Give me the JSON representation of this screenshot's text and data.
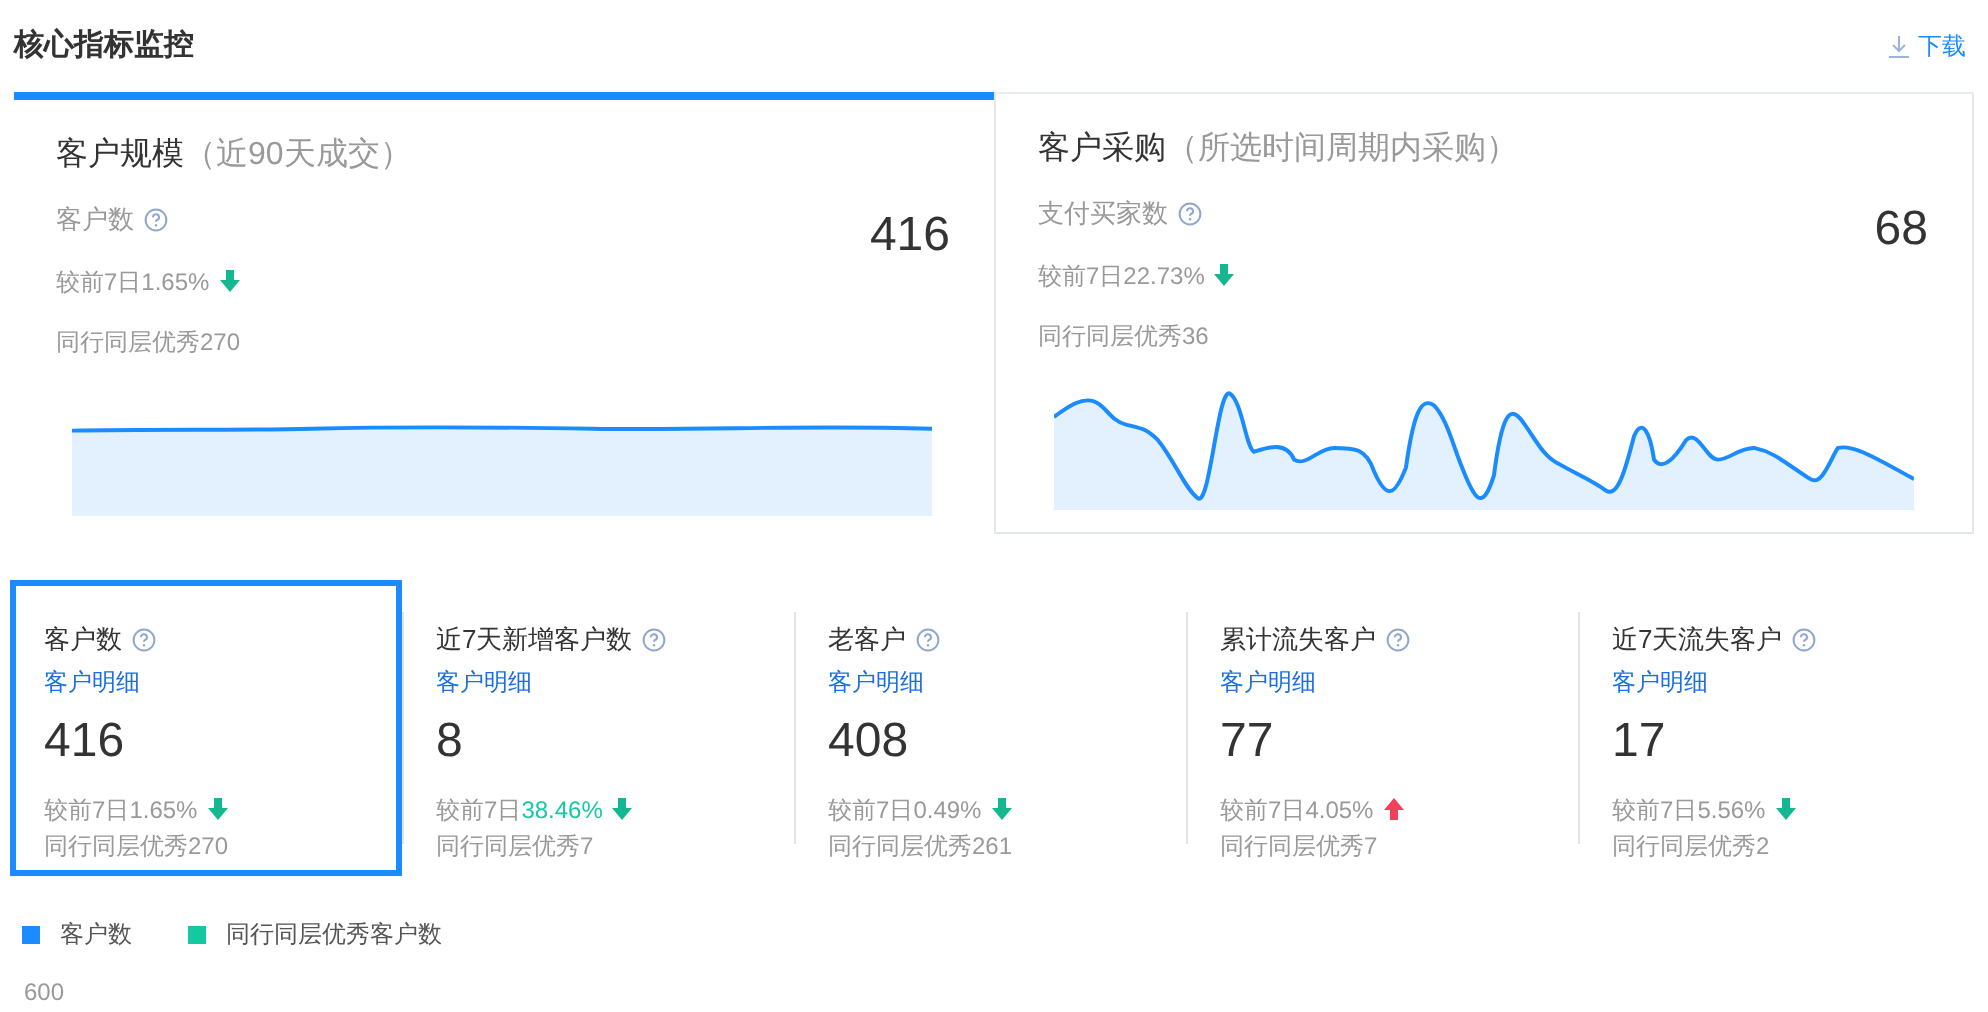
{
  "header": {
    "title": "核心指标监控",
    "download": "下载"
  },
  "overview_cards": [
    {
      "title": "客户规模",
      "subtitle": "（近90天成交）",
      "metric": "客户数",
      "value": "416",
      "change_prefix": "较前7日",
      "change_value": "1.65%",
      "rising": false,
      "peer": "同行同层优秀270",
      "selected": true
    },
    {
      "title": "客户采购",
      "subtitle": "（所选时间周期内采购）",
      "metric": "支付买家数",
      "value": "68",
      "change_prefix": "较前7日",
      "change_value": "22.73%",
      "rising": false,
      "peer": "同行同层优秀36",
      "selected": false
    }
  ],
  "metric_tiles": [
    {
      "label": "客户数",
      "link": "客户明细",
      "value": "416",
      "change_prefix": "较前7日",
      "change_value": "1.65%",
      "highlight": false,
      "rising": false,
      "peer": "同行同层优秀270",
      "selected": true
    },
    {
      "label": "近7天新增客户数",
      "link": "客户明细",
      "value": "8",
      "change_prefix": "较前7日",
      "change_value": "38.46%",
      "highlight": true,
      "rising": false,
      "peer": "同行同层优秀7",
      "selected": false
    },
    {
      "label": "老客户",
      "link": "客户明细",
      "value": "408",
      "change_prefix": "较前7日",
      "change_value": "0.49%",
      "highlight": false,
      "rising": false,
      "peer": "同行同层优秀261",
      "selected": false
    },
    {
      "label": "累计流失客户",
      "link": "客户明细",
      "value": "77",
      "change_prefix": "较前7日",
      "change_value": "4.05%",
      "highlight": false,
      "rising": true,
      "peer": "同行同层优秀7",
      "selected": false
    },
    {
      "label": "近7天流失客户",
      "link": "客户明细",
      "value": "17",
      "change_prefix": "较前7日",
      "change_value": "5.56%",
      "highlight": false,
      "rising": false,
      "peer": "同行同层优秀2",
      "selected": false
    }
  ],
  "chart": {
    "legend": [
      {
        "label": "客户数",
        "color": "#1a8cff"
      },
      {
        "label": "同行同层优秀客户数",
        "color": "#14c9a0"
      }
    ],
    "y_axis_label": "600"
  }
}
